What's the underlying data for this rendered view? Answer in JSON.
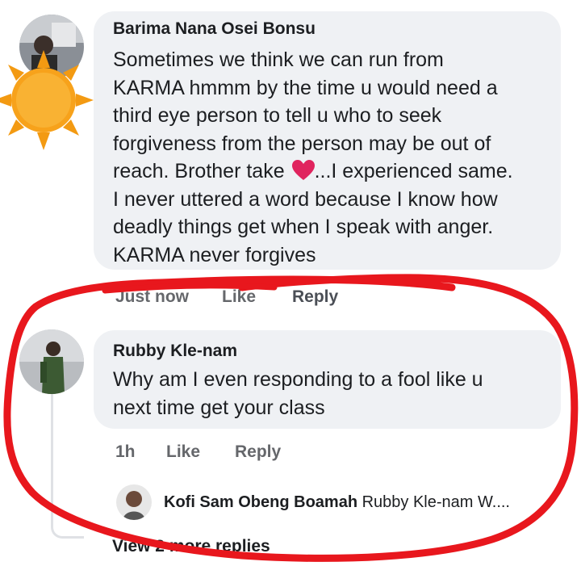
{
  "comments": [
    {
      "author": "Barima Nana Osei Bonsu",
      "lines": [
        "Sometimes we think we can run from",
        "KARMA hmmm by the time u would need a",
        "third eye person to tell u who to seek",
        "forgiveness from the person may be out of",
        "reach. Brother take",
        "I never uttered a word because I know how",
        "deadly things get when I speak with anger.",
        "KARMA never forgives"
      ],
      "line5_after_heart": "...I experienced same.",
      "actions": {
        "time": "Just now",
        "like": "Like",
        "reply": "Reply"
      }
    },
    {
      "author": "Rubby Kle-nam",
      "lines": [
        "Why am I even responding to a fool like u",
        "next time get your class"
      ],
      "actions": {
        "time": "1h",
        "like": "Like",
        "reply": "Reply"
      }
    }
  ],
  "reply_preview": {
    "author": "Kofi Sam Obeng Boamah",
    "text": "Rubby Kle-nam W...."
  },
  "view_more": "View 2 more replies",
  "colors": {
    "bubble": "#eff1f4",
    "secondary_text": "#65676b",
    "scribble": "#e8171d",
    "heart": "#e0245e",
    "sun": "#f7a21b"
  },
  "icons": [
    "sun-emoji-icon",
    "heart-emoji-icon"
  ]
}
